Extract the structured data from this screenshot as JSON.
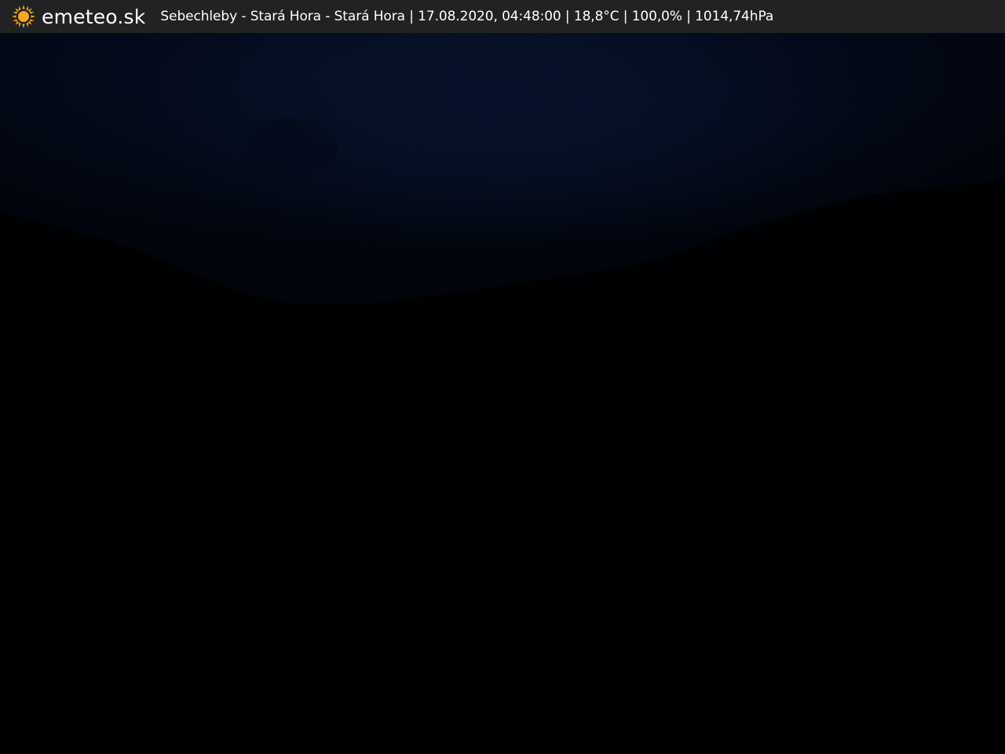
{
  "header": {
    "logo_text": "emeteo.sk",
    "caption": "Sebechleby - Stará Hora - Stará Hora | 17.08.2020, 04:48:00 | 18,8°C | 100,0% | 1014,74hPa"
  },
  "colors": {
    "header_background": "#222222",
    "header_text": "#ffffff",
    "sun_icon": "#f5a623",
    "sky": "#020816",
    "ground": "#000000"
  },
  "icons": {
    "logo": "sun-icon"
  }
}
